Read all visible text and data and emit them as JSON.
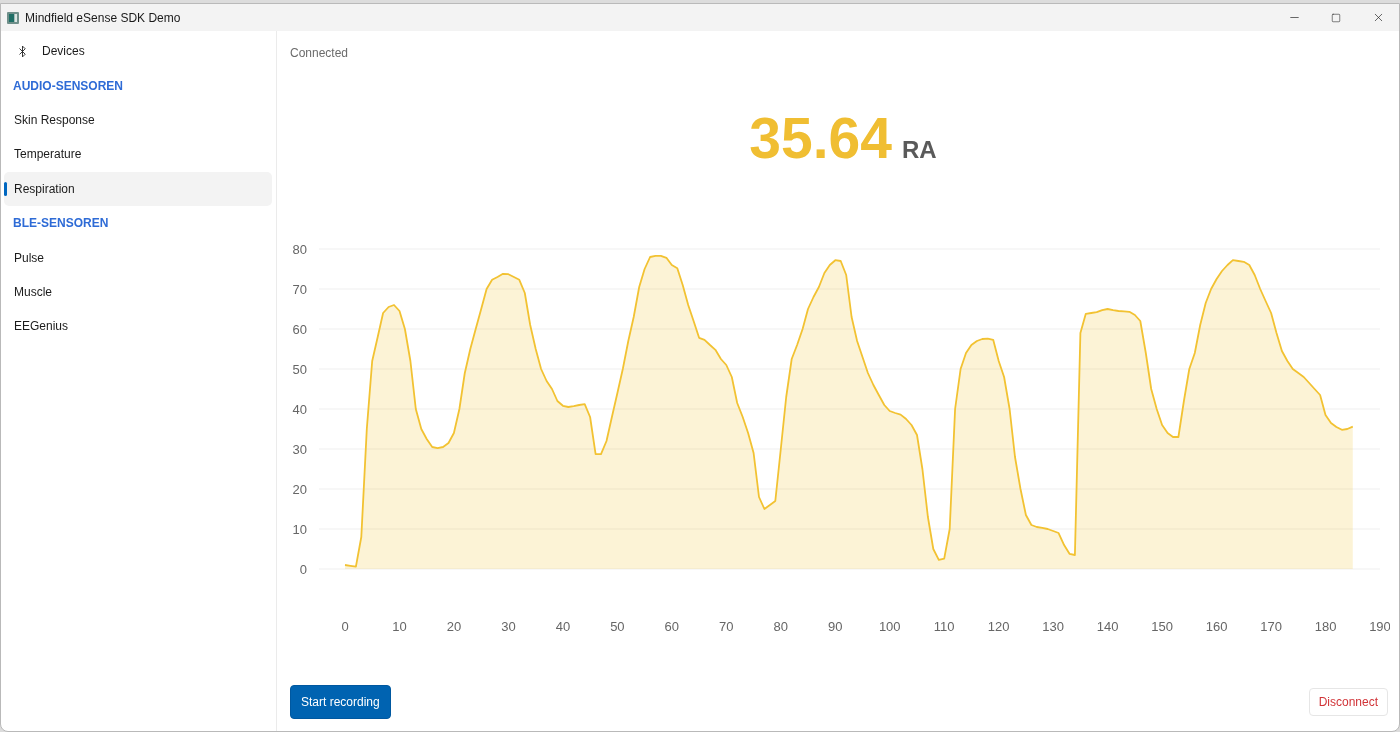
{
  "window": {
    "title": "Mindfield eSense SDK Demo"
  },
  "sidebar": {
    "devices_item": {
      "label": "Devices",
      "selected": false
    },
    "groups": [
      {
        "title": "AUDIO-SENSOREN",
        "items": [
          {
            "label": "Skin Response",
            "selected": false
          },
          {
            "label": "Temperature",
            "selected": false
          },
          {
            "label": "Respiration",
            "selected": true
          }
        ]
      },
      {
        "title": "BLE-SENSOREN",
        "items": [
          {
            "label": "Pulse",
            "selected": false
          },
          {
            "label": "Muscle",
            "selected": false
          },
          {
            "label": "EEGenius",
            "selected": false
          }
        ]
      }
    ]
  },
  "main": {
    "status": "Connected",
    "reading": {
      "value": "35.64",
      "unit": "RA"
    },
    "chart_data": {
      "type": "area",
      "grid": true,
      "x": [
        0,
        1,
        2,
        3,
        4,
        5,
        6,
        7,
        8,
        9,
        10,
        11,
        12,
        13,
        14,
        15,
        16,
        17,
        18,
        19,
        20,
        21,
        22,
        23,
        24,
        25,
        26,
        27,
        28,
        29,
        30,
        31,
        32,
        33,
        34,
        35,
        36,
        37,
        38,
        39,
        40,
        41,
        42,
        43,
        44,
        45,
        46,
        47,
        48,
        49,
        50,
        51,
        52,
        53,
        54,
        55,
        56,
        57,
        58,
        59,
        60,
        61,
        62,
        63,
        64,
        65,
        66,
        67,
        68,
        69,
        70,
        71,
        72,
        73,
        74,
        75,
        76,
        77,
        78,
        79,
        80,
        81,
        82,
        83,
        84,
        85,
        86,
        87,
        88,
        89,
        90,
        91,
        92,
        93,
        94,
        95,
        96,
        97,
        98,
        99,
        100,
        101,
        102,
        103,
        104,
        105,
        106,
        107,
        108,
        109,
        110,
        111,
        112,
        113,
        114,
        115,
        116,
        117,
        118,
        119,
        120,
        121,
        122,
        123,
        124,
        125,
        126,
        127,
        128,
        129,
        130,
        131,
        132,
        133,
        134,
        135,
        136,
        137,
        138,
        139,
        140,
        141,
        142,
        143,
        144,
        145,
        146,
        147,
        148,
        149,
        150,
        151,
        152,
        153,
        154,
        155,
        156,
        157,
        158,
        159,
        160,
        161,
        162,
        163,
        164,
        165,
        166,
        167,
        168,
        169,
        170,
        171,
        172,
        173,
        174,
        175,
        176,
        177,
        178,
        179,
        180,
        181,
        182,
        183,
        184,
        185
      ],
      "series": [
        {
          "color": "#f2c232",
          "values": [
            1,
            0.8,
            0.6,
            8,
            35,
            52,
            58,
            64,
            65.5,
            66,
            64.5,
            60,
            52,
            40,
            35,
            32.5,
            30.5,
            30.2,
            30.5,
            31.5,
            34,
            40,
            49,
            55,
            60,
            65,
            70,
            72.3,
            73,
            73.8,
            73.7,
            73,
            72.3,
            69,
            61,
            55,
            50,
            47,
            45,
            42,
            40.8,
            40.5,
            40.7,
            41,
            41.2,
            38,
            28.7,
            28.7,
            32,
            38,
            44,
            50,
            57,
            63,
            70.5,
            75,
            78,
            78.3,
            78.3,
            77.8,
            76,
            75.2,
            71,
            66,
            62,
            57.8,
            57.3,
            56,
            54.8,
            52.5,
            51,
            48,
            41.5,
            38,
            34,
            29,
            18,
            15,
            16,
            17,
            30,
            43,
            52.5,
            56,
            60,
            65,
            68,
            70.5,
            74,
            76,
            77.2,
            77,
            73.5,
            63,
            57,
            53,
            49,
            46,
            43.5,
            41,
            39.5,
            39,
            38.6,
            37.5,
            36,
            33.5,
            25,
            13,
            5,
            2.3,
            2.6,
            10,
            40,
            50,
            54,
            56,
            57,
            57.5,
            57.6,
            57.3,
            52,
            48,
            40,
            28,
            20,
            13.5,
            11,
            10.5,
            10.3,
            10,
            9.5,
            9,
            6,
            3.8,
            3.5,
            59,
            63.8,
            64,
            64.2,
            64.7,
            65,
            64.7,
            64.5,
            64.4,
            64.3,
            63.5,
            62,
            54,
            45,
            40,
            36,
            34,
            33,
            33,
            42,
            50,
            54,
            61,
            66.5,
            70,
            72.5,
            74.5,
            76,
            77.2,
            77,
            76.8,
            76,
            73.5,
            70,
            67,
            64,
            59,
            54.5,
            52,
            50,
            49,
            48,
            46.5,
            45,
            43.5,
            38.5,
            36.5,
            35.5,
            34.8,
            35,
            35.6
          ]
        }
      ],
      "xlim": [
        0,
        190
      ],
      "ylim": [
        0,
        80
      ],
      "xticks": [
        0,
        10,
        20,
        30,
        40,
        50,
        60,
        70,
        80,
        90,
        100,
        110,
        120,
        130,
        140,
        150,
        160,
        170,
        180,
        190
      ],
      "yticks": [
        0,
        10,
        20,
        30,
        40,
        50,
        60,
        70,
        80
      ]
    },
    "buttons": [
      {
        "kind": "primary",
        "label": "Start recording"
      },
      {
        "kind": "danger",
        "label": "Disconnect"
      }
    ]
  }
}
